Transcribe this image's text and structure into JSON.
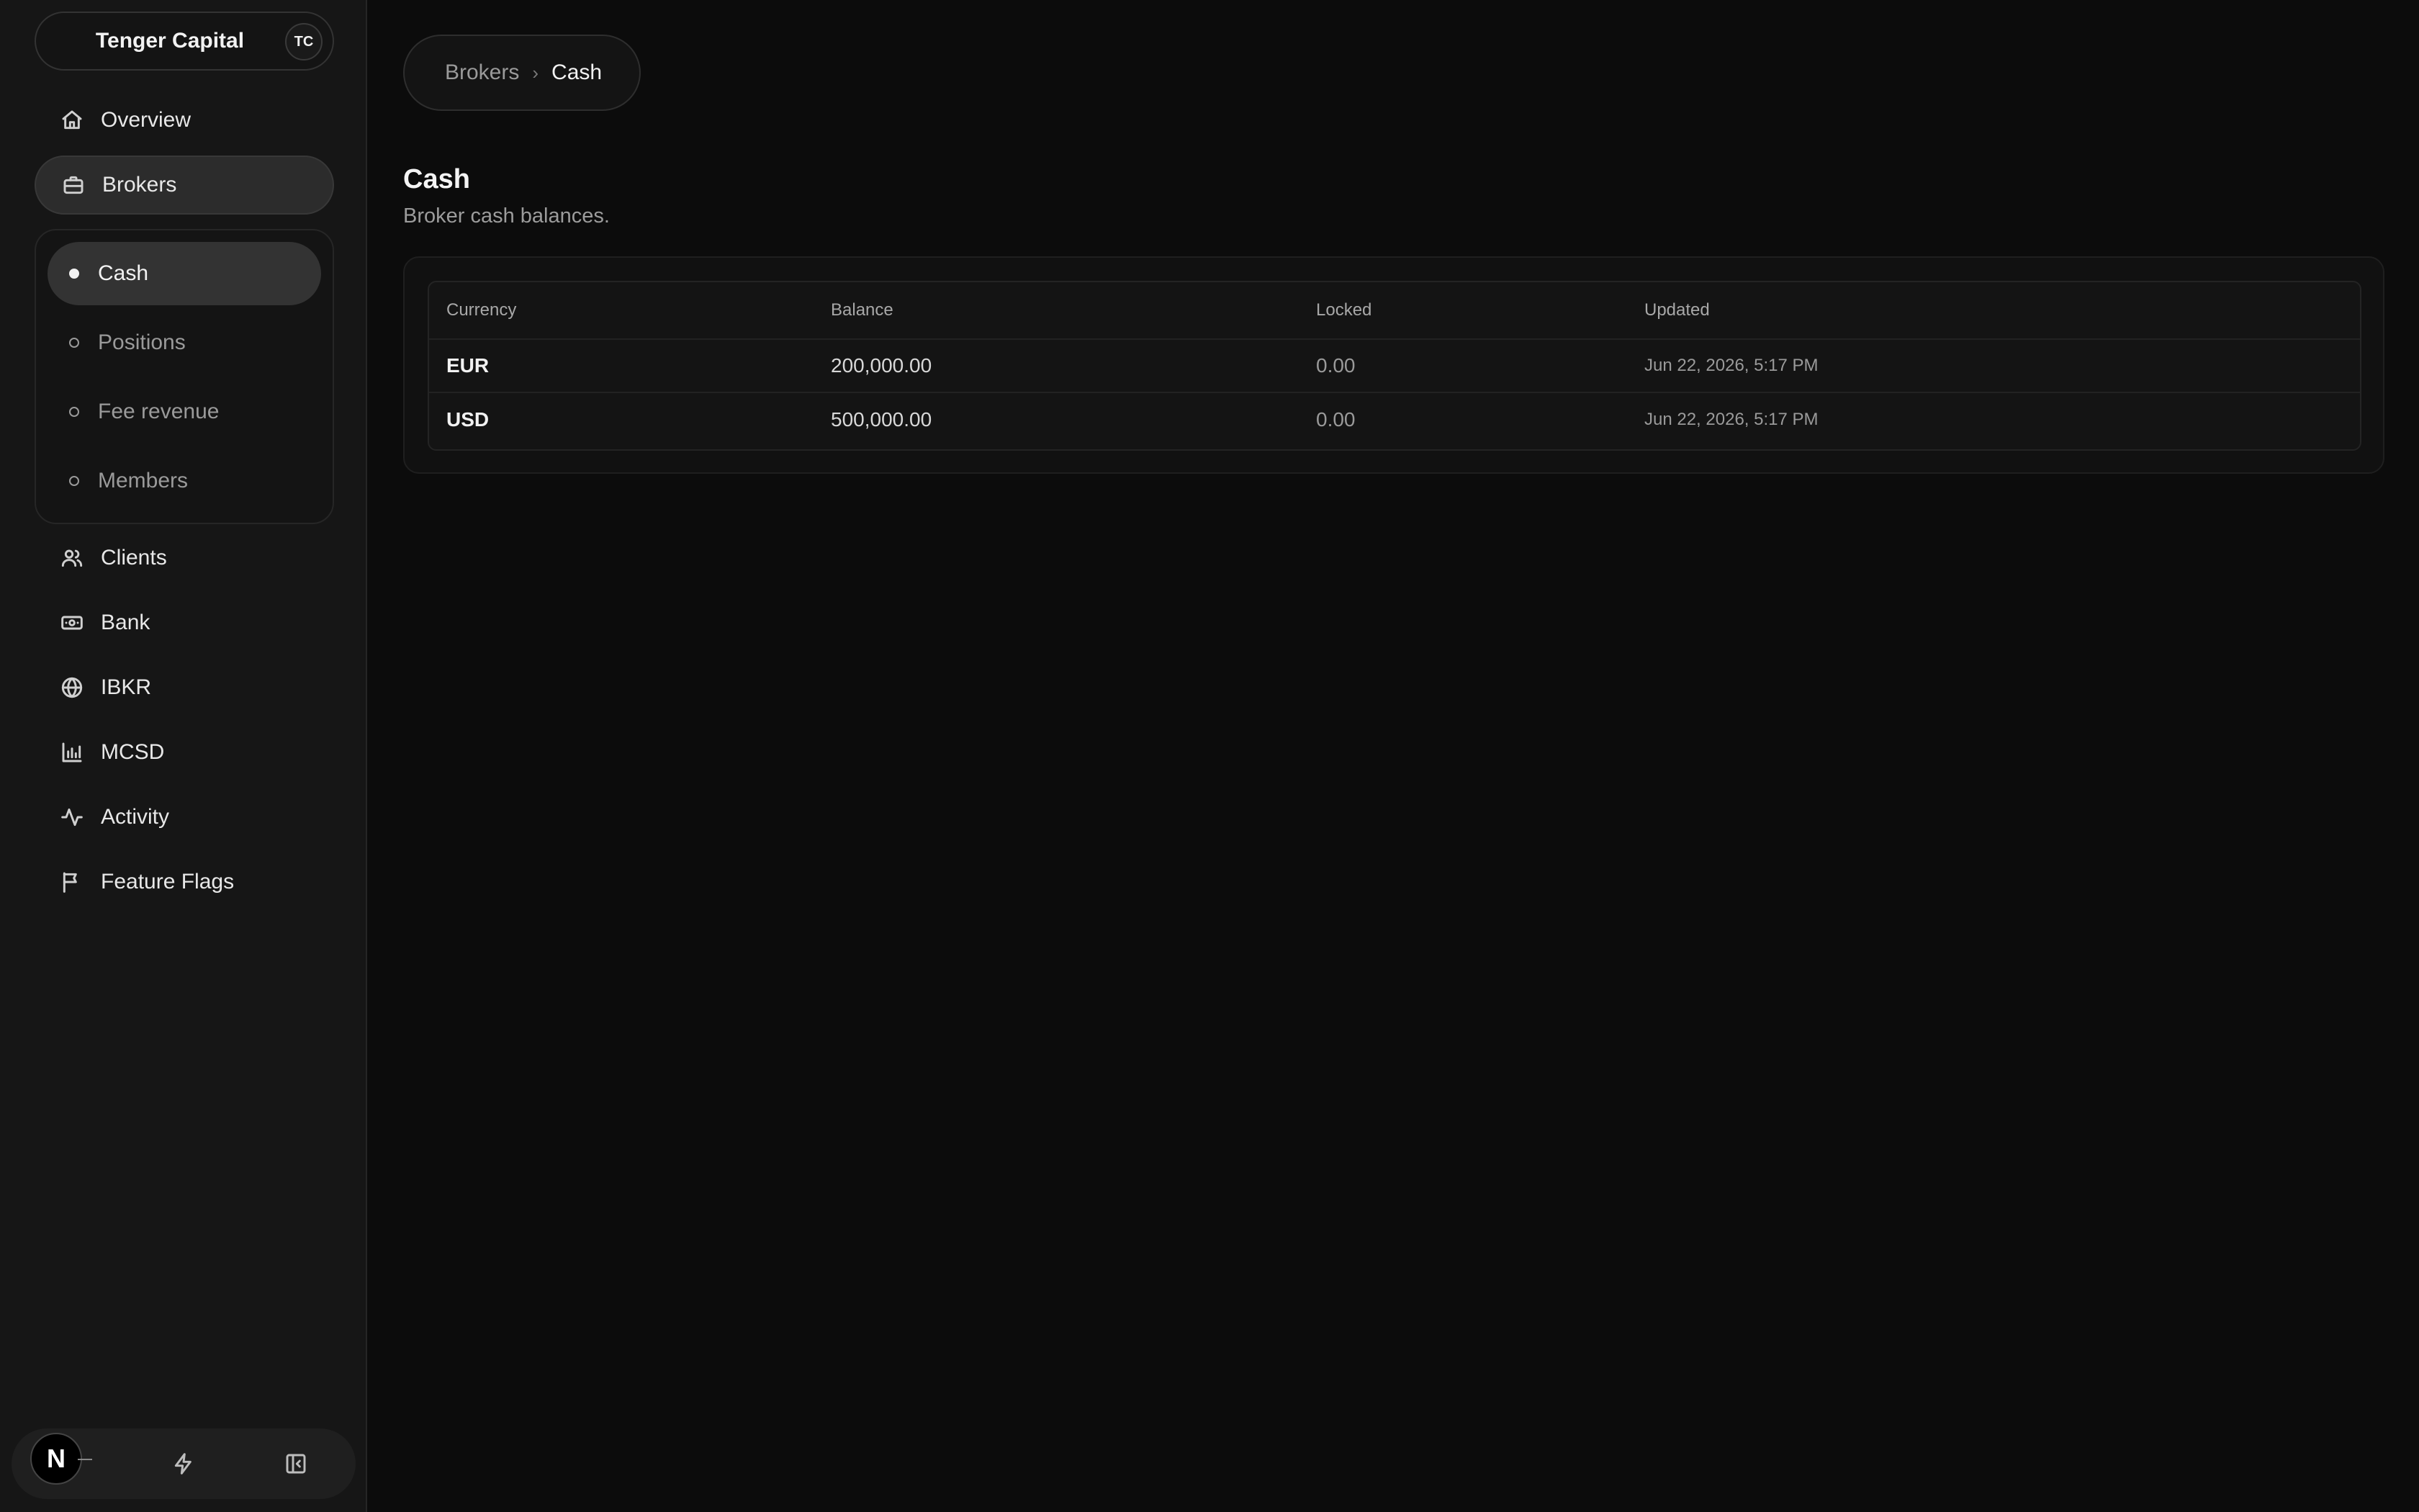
{
  "org": {
    "name": "Tenger Capital",
    "initials": "TC"
  },
  "sidebar": {
    "nav": [
      {
        "label": "Overview",
        "icon": "home-icon"
      },
      {
        "label": "Brokers",
        "icon": "briefcase-icon",
        "active": true
      },
      {
        "label": "Clients",
        "icon": "users-icon"
      },
      {
        "label": "Bank",
        "icon": "banknote-icon"
      },
      {
        "label": "IBKR",
        "icon": "globe-icon"
      },
      {
        "label": "MCSD",
        "icon": "bar-chart-icon"
      },
      {
        "label": "Activity",
        "icon": "activity-icon"
      },
      {
        "label": "Feature Flags",
        "icon": "flag-icon"
      }
    ],
    "subnav": [
      {
        "label": "Cash",
        "active": true
      },
      {
        "label": "Positions"
      },
      {
        "label": "Fee revenue"
      },
      {
        "label": "Members"
      }
    ],
    "bottom": {
      "logo_letter": "N",
      "icons": [
        "zap-icon",
        "panel-left-icon"
      ]
    }
  },
  "breadcrumb": {
    "parent": "Brokers",
    "separator": "›",
    "current": "Cash"
  },
  "page": {
    "title": "Cash",
    "subtitle": "Broker cash balances."
  },
  "table": {
    "headers": [
      "Currency",
      "Balance",
      "Locked",
      "Updated"
    ],
    "rows": [
      {
        "currency": "EUR",
        "balance": "200,000.00",
        "locked": "0.00",
        "updated": "Jun 22, 2026, 5:17 PM"
      },
      {
        "currency": "USD",
        "balance": "500,000.00",
        "locked": "0.00",
        "updated": "Jun 22, 2026, 5:17 PM"
      }
    ]
  },
  "colors": {
    "background": "#0c0c0c",
    "sidebar": "#161616",
    "active_item": "#2c2c2c",
    "text_primary": "#f2f2f2",
    "text_muted": "#9a9a9a"
  }
}
